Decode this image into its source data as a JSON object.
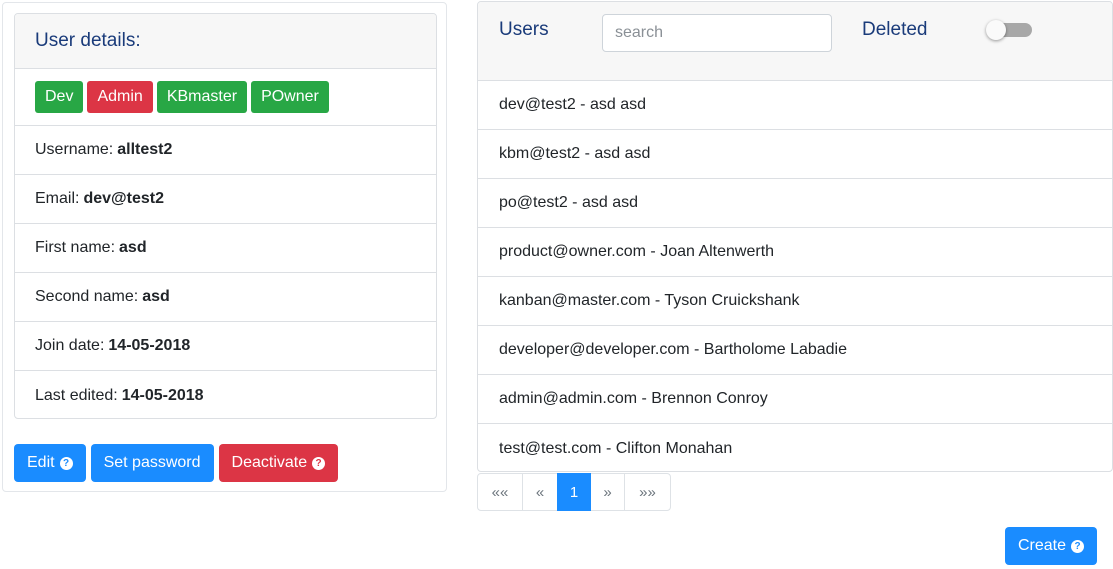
{
  "user_details": {
    "title": "User details:",
    "roles": [
      {
        "label": "Dev",
        "color": "#28a745"
      },
      {
        "label": "Admin",
        "color": "#dc3545"
      },
      {
        "label": "KBmaster",
        "color": "#28a745"
      },
      {
        "label": "POwner",
        "color": "#28a745"
      }
    ],
    "fields": [
      {
        "label": "Username:",
        "value": "alltest2"
      },
      {
        "label": "Email:",
        "value": "dev@test2"
      },
      {
        "label": "First name:",
        "value": "asd"
      },
      {
        "label": "Second name:",
        "value": "asd"
      },
      {
        "label": "Join date:",
        "value": "14-05-2018"
      },
      {
        "label": "Last edited:",
        "value": "14-05-2018"
      }
    ],
    "actions": {
      "edit_label": "Edit",
      "set_password_label": "Set password",
      "deactivate_label": "Deactivate"
    }
  },
  "users": {
    "title": "Users",
    "search_placeholder": "search",
    "deleted_label": "Deleted",
    "deleted_toggle_on": false,
    "list": [
      "dev@test2 - asd asd",
      "kbm@test2 - asd asd",
      "po@test2 - asd asd",
      "product@owner.com - Joan Altenwerth",
      "kanban@master.com - Tyson Cruickshank",
      "developer@developer.com - Bartholome Labadie",
      "admin@admin.com - Brennon Conroy",
      "test@test.com - Clifton Monahan"
    ],
    "pagination": {
      "first": "««",
      "prev": "«",
      "current": "1",
      "next": "»",
      "last": "»»"
    },
    "create_label": "Create"
  },
  "colors": {
    "primary": "#1a8cff",
    "danger": "#dc3545",
    "success": "#28a745",
    "heading": "#1a3b7a"
  },
  "icons": {
    "help": "question-circle-icon"
  }
}
